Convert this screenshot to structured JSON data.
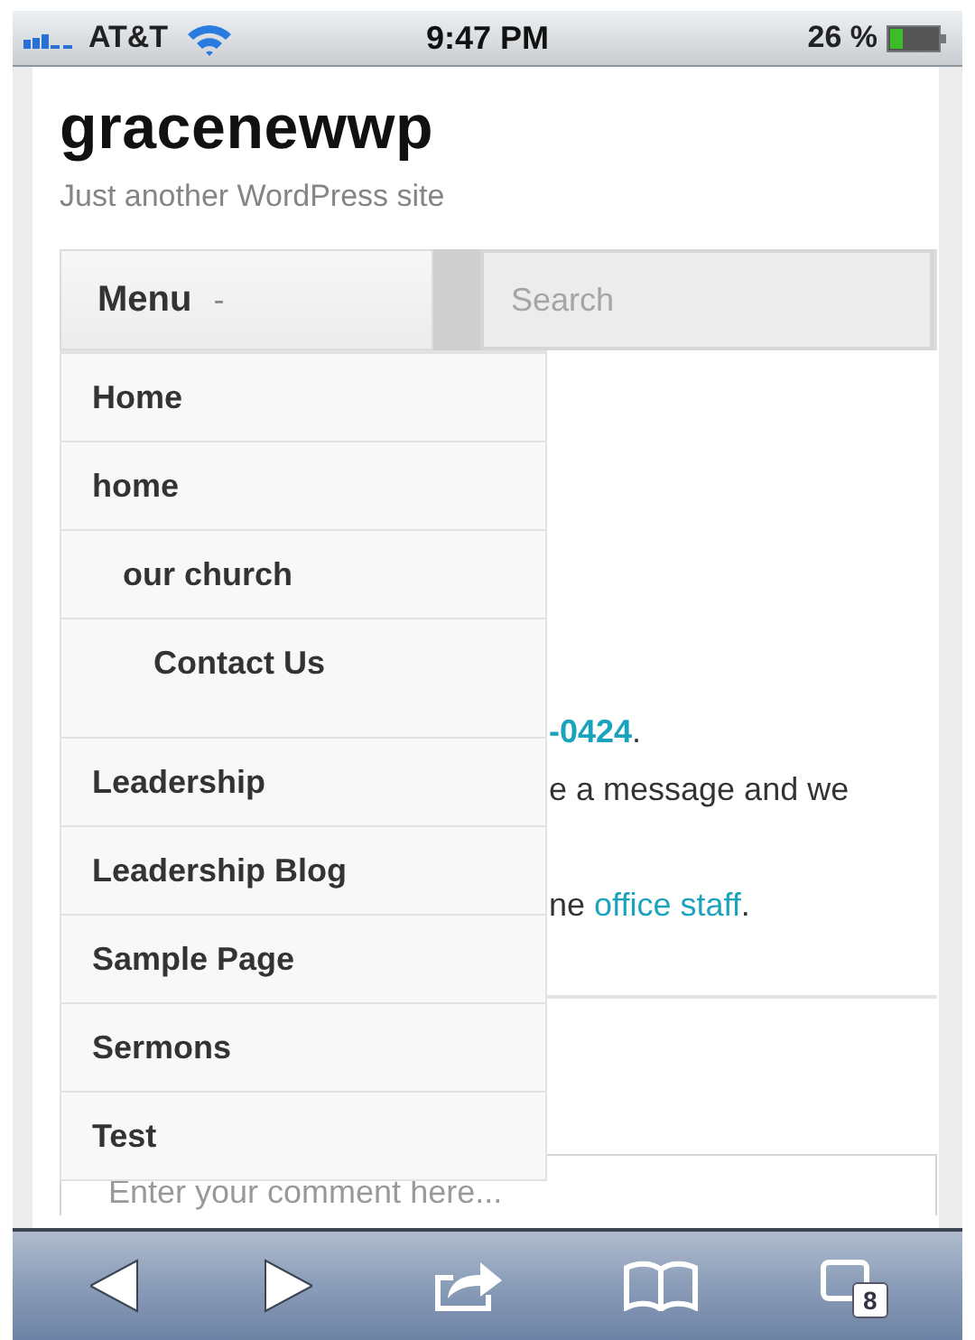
{
  "status_bar": {
    "carrier": "AT&T",
    "time": "9:47 PM",
    "battery": "26 %"
  },
  "site": {
    "title": "gracenewwp",
    "tagline": "Just another WordPress site"
  },
  "menu": {
    "label": "Menu",
    "toggle": "-",
    "expanded": true,
    "items": [
      {
        "label": "Home"
      },
      {
        "label": "home",
        "children": [
          {
            "label": "our church",
            "children": [
              {
                "label": "Contact Us"
              }
            ]
          }
        ]
      },
      {
        "label": "Leadership"
      },
      {
        "label": "Leadership Blog"
      },
      {
        "label": "Sample Page"
      },
      {
        "label": "Sermons"
      },
      {
        "label": "Test"
      }
    ]
  },
  "search": {
    "placeholder": "Search"
  },
  "content": {
    "phone_link": "-0424",
    "phone_after": ".",
    "line_2": "e a message and we",
    "line_3": {
      "before": "ne ",
      "link": "office staff",
      "after": "."
    }
  },
  "comment": {
    "placeholder": "Enter your comment here..."
  },
  "toolbar": {
    "tabs_count": "8"
  }
}
